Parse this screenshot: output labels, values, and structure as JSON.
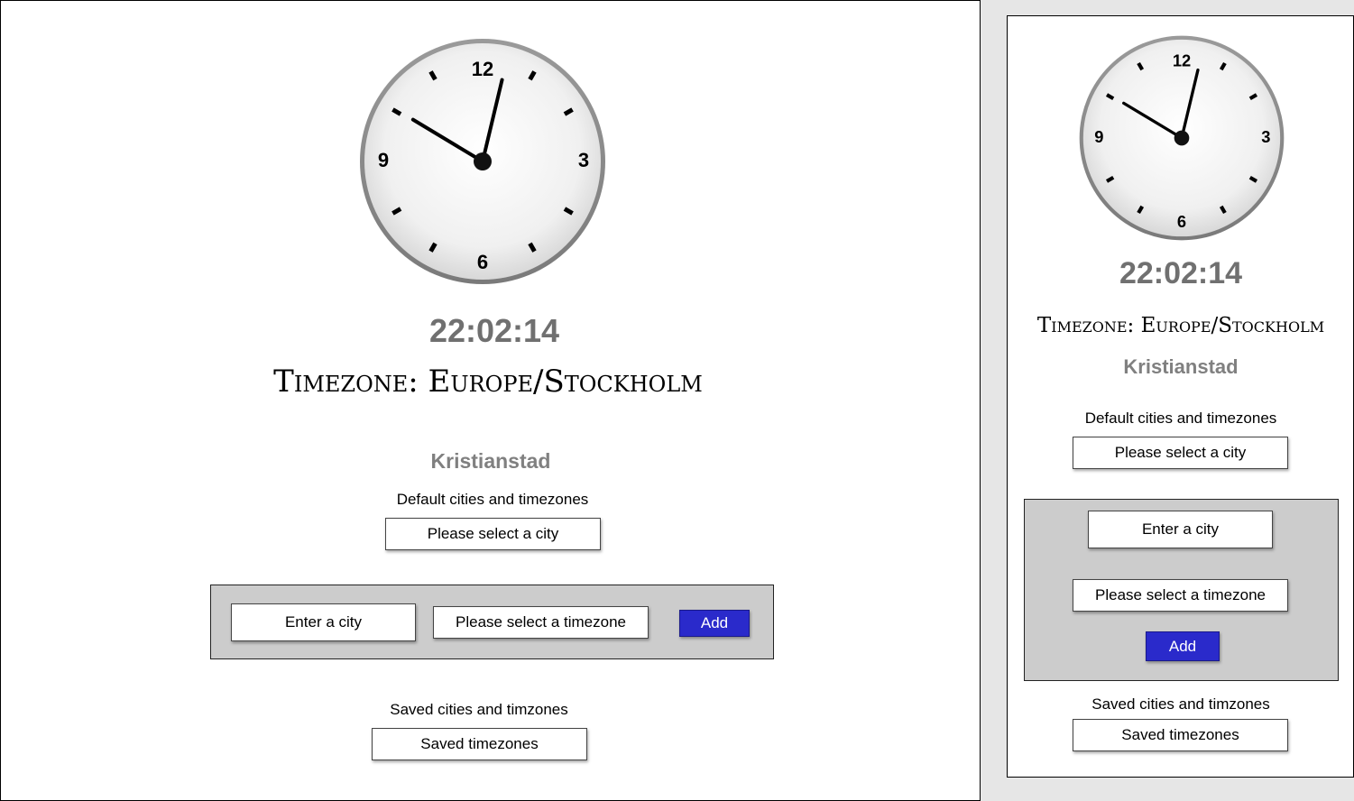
{
  "clock": {
    "numerals": {
      "twelve": "12",
      "three": "3",
      "six": "6",
      "nine": "9"
    },
    "time": {
      "hours": 22,
      "minutes": 2,
      "seconds": 14
    }
  },
  "digital_time": "22:02:14",
  "timezone_title": "Timezone: Europe/Stockholm",
  "city_name": "Kristianstad",
  "default_label": "Default cities and timezones",
  "city_select": "Please select a city",
  "city_input": "Enter a city",
  "timezone_select": "Please select a timezone",
  "add_label": "Add",
  "saved_label": "Saved cities and timzones",
  "saved_select": "Saved timezones",
  "colors": {
    "add_button": "#2a2acb",
    "form_box": "#cccccc",
    "digital_text": "#707070",
    "page_bg": "#e6e6e6"
  }
}
